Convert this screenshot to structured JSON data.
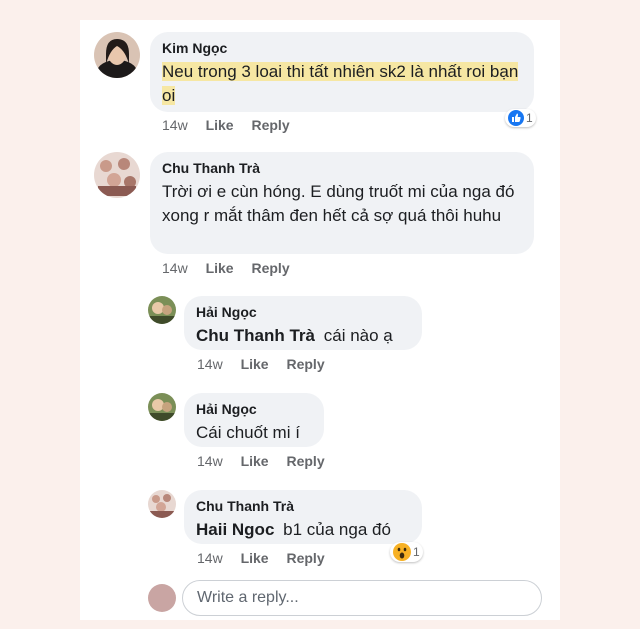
{
  "comments": [
    {
      "author": "Kim Ngọc",
      "text": "Neu trong 3 loai thi tất nhiên sk2 là nhất roi bạn oi",
      "time": "14w",
      "like": "Like",
      "reply": "Reply",
      "reaction": {
        "icon": "thumbs-up-icon",
        "count": "1",
        "color": "#1877f2"
      }
    },
    {
      "author": "Chu Thanh Trà",
      "text": "Trời ơi e cùn hóng. E dùng truốt mi của nga đó xong r mắt thâm đen hết cả sợ quá thôi huhu",
      "time": "14w",
      "like": "Like",
      "reply": "Reply"
    }
  ],
  "replies": [
    {
      "author": "Hải Ngọc",
      "mention": "Chu Thanh Trà",
      "text": "cái nào ạ",
      "time": "14w",
      "like": "Like",
      "reply": "Reply"
    },
    {
      "author": "Hải Ngọc",
      "text": "Cái chuốt mi í",
      "time": "14w",
      "like": "Like",
      "reply": "Reply"
    },
    {
      "author": "Chu Thanh Trà",
      "mention": "Haii Ngoc",
      "text": "b1 của nga đó",
      "time": "14w",
      "like": "Like",
      "reply": "Reply",
      "reaction": {
        "icon": "wow-icon",
        "count": "1",
        "color": "#f7b125"
      }
    }
  ],
  "reply_box": {
    "placeholder": "Write a reply..."
  },
  "colors": {
    "highlight": "#f6e7a3",
    "bubble": "#f0f2f5",
    "meta": "#65676b"
  }
}
